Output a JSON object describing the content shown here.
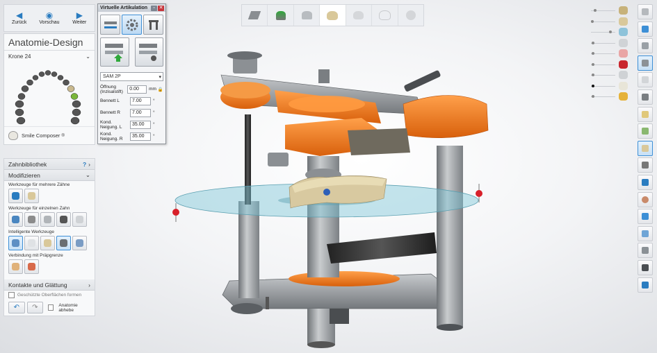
{
  "nav": {
    "back_label": "Zurück",
    "preview_label": "Vorschau",
    "next_label": "Weiter"
  },
  "left": {
    "title": "Anatomie-Design",
    "crown_label": "Krone 24",
    "smile_composer": "Smile Composer",
    "smile_mark": "®"
  },
  "library": {
    "title": "Zahnbibliothek",
    "help": "?"
  },
  "modify": {
    "title": "Modifizieren",
    "group_multi": "Werkzeuge für mehrere Zähne",
    "group_single": "Werkzeuge für einzelnen Zahn",
    "group_smart": "Intelligente Werkzeuge",
    "group_prep": "Verbindung mit Präpgrenze"
  },
  "contacts": {
    "title": "Kontakte und Glättung",
    "protected_surfaces": "Geschützte Oberflächen formen",
    "anatomy_lift": "Anatomie abhebe"
  },
  "dialog": {
    "title": "Virtuelle Artikulation",
    "select_value": "SAM 2P",
    "fields": [
      {
        "label": "Öffnung (Inzisalstift)",
        "value": "0.00",
        "unit": "mm"
      },
      {
        "label": "Bennett L",
        "value": "7.00",
        "unit": "°"
      },
      {
        "label": "Bennett R",
        "value": "7.00",
        "unit": "°"
      },
      {
        "label": "Kond. Neigung. L",
        "value": "35.00",
        "unit": "°"
      },
      {
        "label": "Kond. Neigung. R",
        "value": "35.00",
        "unit": "°"
      }
    ]
  },
  "colors": {
    "accent": "#2a7cc0",
    "orange": "#f07a1a",
    "steel": "#9ea2a6",
    "dark": "#3a3d40",
    "plane": "#7cc6d6",
    "marker": "#d8202a"
  },
  "icons": {
    "top_toolbar": [
      "scan-icon",
      "die-icon",
      "margin-icon",
      "crown-icon",
      "tooth-icon",
      "tooth-outline-icon",
      "disc-icon"
    ],
    "right_toolbar": [
      "model-icon",
      "crown-icon",
      "sculpt-icon",
      "contact-icon",
      "occlusal-icon",
      "articulator-icon",
      "jaw-icon",
      "face-icon",
      "warning-icon",
      "check-icon",
      "shield-icon",
      "axis-icon",
      "camera-icon"
    ]
  }
}
